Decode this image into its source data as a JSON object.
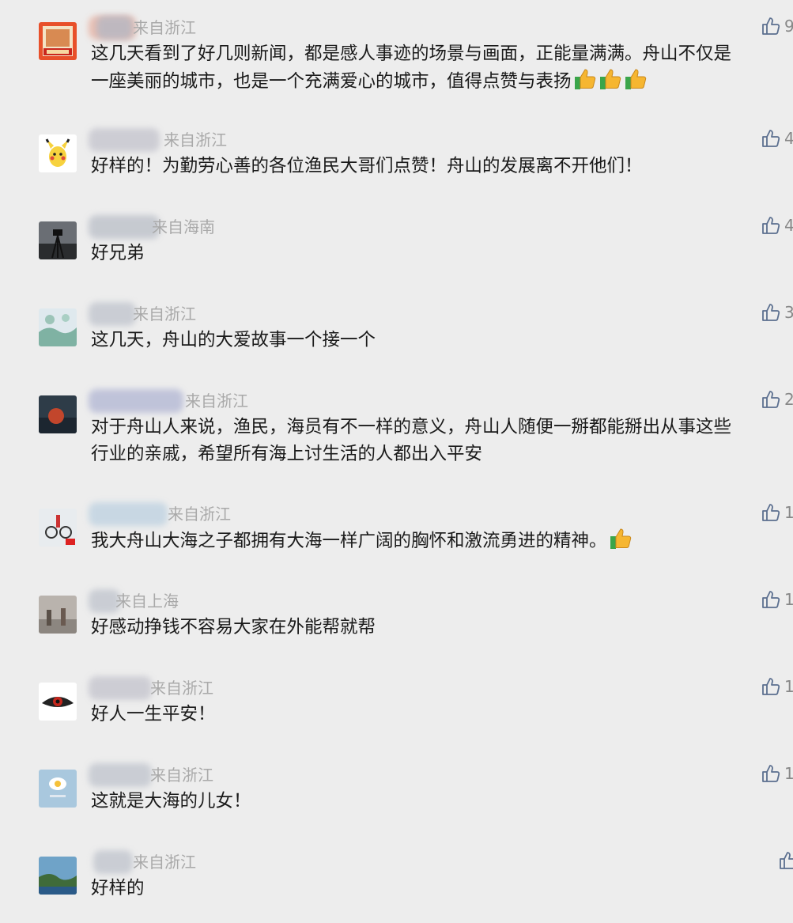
{
  "comments": [
    {
      "location": "来自浙江",
      "text": "这几天看到了好几则新闻，都是感人事迹的场景与画面，正能量满满。舟山不仅是",
      "text2": "一座美丽的城市，也是一个充满爱心的城市，值得点赞与表扬",
      "likes": "9",
      "emoji_count": 3
    },
    {
      "location": "来自浙江",
      "text": "好样的！为勤劳心善的各位渔民大哥们点赞！舟山的发展离不开他们！",
      "likes": "4"
    },
    {
      "location": "来自海南",
      "text": "好兄弟",
      "likes": "4"
    },
    {
      "location": "来自浙江",
      "text": "这几天，舟山的大爱故事一个接一个",
      "likes": "3"
    },
    {
      "location": "来自浙江",
      "text": "对于舟山人来说，渔民，海员有不一样的意义，舟山人随便一掰都能掰出从事这些",
      "text2": "行业的亲戚，希望所有海上讨生活的人都出入平安",
      "likes": "2"
    },
    {
      "location": "来自浙江",
      "text": "我大舟山大海之子都拥有大海一样广阔的胸怀和激流勇进的精神。",
      "likes": "1",
      "emoji_count": 1
    },
    {
      "location": "来自上海",
      "text": "好感动挣钱不容易大家在外能帮就帮",
      "likes": "1"
    },
    {
      "location": "来自浙江",
      "text": "好人一生平安！",
      "likes": "1"
    },
    {
      "location": "来自浙江",
      "text": "这就是大海的儿女！",
      "likes": "1"
    },
    {
      "location": "来自浙江",
      "text": "好样的",
      "likes": ""
    }
  ]
}
